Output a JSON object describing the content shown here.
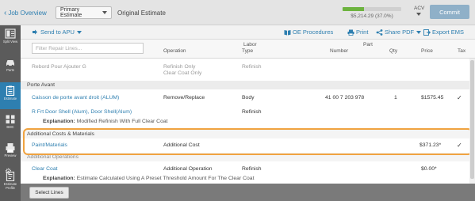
{
  "topbar": {
    "back_label": "Job Overview",
    "estimate_select": "Primary Estimate",
    "estimate_name": "Original Estimate",
    "progress_text": "$5,214.29 (37.0%)",
    "progress_fraction": 0.37,
    "acv_label": "ACV",
    "commit_label": "Commit",
    "accent_color": "#2e7fb0",
    "progress_color": "#6db33f"
  },
  "rail": {
    "items": [
      {
        "label": "Split View",
        "icon": "split-view-icon"
      },
      {
        "label": "Parts",
        "icon": "car-icon"
      },
      {
        "label": "Estimate",
        "icon": "clipboard-icon"
      },
      {
        "label": "BMC",
        "icon": "grid-icon"
      },
      {
        "label": "Preview",
        "icon": "print-icon"
      },
      {
        "label": "Estimate Profile",
        "icon": "profile-icon"
      }
    ]
  },
  "toolbar": {
    "send_to_apu": "Send to APU",
    "oe_procedures": "OE Procedures",
    "print": "Print",
    "share_pdf": "Share PDF",
    "export_ems": "Export EMS"
  },
  "header": {
    "filter_placeholder": "Filter Repair Lines...",
    "col_operation": "Operation",
    "col_labor": "Labor",
    "col_type": "Type",
    "col_part": "Part",
    "col_number": "Number",
    "col_qty": "Qty",
    "col_price": "Price",
    "col_tax": "Tax"
  },
  "rows": {
    "r1": {
      "desc": "Rebord Pour Ajouter G",
      "operation": "Refinish Only",
      "operation2": "Clear Coat Only",
      "type": "Refinish"
    },
    "sec1": "Porte Avant",
    "r2": {
      "desc": "Caisson de porte avant droit (ALUM)",
      "operation": "Remove/Replace",
      "type": "Body",
      "number": "41 00 7 203 978",
      "qty": "1",
      "price": "$1575.45",
      "tax": "✓"
    },
    "r3": {
      "desc": "R Frt Door Shell (Alum), Door Shell(Alum)",
      "type": "Refinish",
      "explain_label": "Explanation:",
      "explain": "Modified Refinish With Full Clear Coat"
    },
    "sec2": "Additional Costs & Materials",
    "r4": {
      "desc": "Paint/Materials",
      "operation": "Additional Cost",
      "price": "$371.23*",
      "tax": "✓"
    },
    "sec3": "Additional Operations",
    "r5": {
      "desc": "Clear Coat",
      "operation": "Additional Operation",
      "type": "Refinish",
      "price": "$0.00*",
      "explain_label": "Explanation:",
      "explain": "Estimate Calculated Using A Preset Threshold Amount For The Clear Coat"
    }
  },
  "bottom": {
    "select_lines": "Select Lines"
  }
}
